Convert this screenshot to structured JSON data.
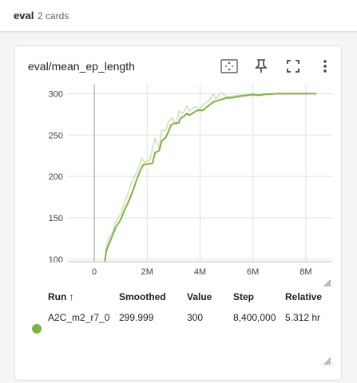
{
  "group": {
    "title": "eval",
    "count": "2 cards"
  },
  "card": {
    "title": "eval/mean_ep_length",
    "tools": [
      "fit-domain-icon",
      "pin-icon",
      "fullscreen-icon",
      "more-vert-icon"
    ]
  },
  "table": {
    "headers": {
      "run": "Run ↑",
      "smoothed": "Smoothed",
      "value": "Value",
      "step": "Step",
      "relative": "Relative"
    },
    "rows": [
      {
        "run": "A2C_m2_r7_0",
        "smoothed": "299.999",
        "value": "300",
        "step": "8,400,000",
        "relative": "5.312 hr",
        "color": "#7cb342"
      }
    ]
  },
  "chart_data": {
    "type": "line",
    "title": "",
    "xlabel": "",
    "ylabel": "",
    "xlim": [
      -1000000,
      9000000
    ],
    "ylim": [
      97,
      312
    ],
    "x_ticks": [
      0,
      2000000,
      4000000,
      6000000,
      8000000
    ],
    "x_tick_labels": [
      "0",
      "2M",
      "4M",
      "6M",
      "8M"
    ],
    "y_ticks": [
      100,
      150,
      200,
      250,
      300
    ],
    "y_tick_labels": [
      "100",
      "150",
      "200",
      "250",
      "300"
    ],
    "grid": true,
    "series_color": "#7cb342",
    "raw_color": "#cfe3b8",
    "series": [
      {
        "name": "A2C_m2_r7_0",
        "smoothed": [
          [
            400000,
            97
          ],
          [
            450000,
            110
          ],
          [
            550000,
            118
          ],
          [
            700000,
            130
          ],
          [
            800000,
            138
          ],
          [
            1000000,
            148
          ],
          [
            1150000,
            160
          ],
          [
            1300000,
            170
          ],
          [
            1450000,
            182
          ],
          [
            1600000,
            196
          ],
          [
            1750000,
            208
          ],
          [
            1850000,
            214
          ],
          [
            2000000,
            215
          ],
          [
            2200000,
            216
          ],
          [
            2300000,
            229
          ],
          [
            2450000,
            231
          ],
          [
            2550000,
            243
          ],
          [
            2700000,
            247
          ],
          [
            2800000,
            254
          ],
          [
            2900000,
            262
          ],
          [
            3000000,
            264
          ],
          [
            3200000,
            265
          ],
          [
            3250000,
            270
          ],
          [
            3400000,
            273
          ],
          [
            3500000,
            276
          ],
          [
            3600000,
            274
          ],
          [
            3750000,
            277
          ],
          [
            3900000,
            280
          ],
          [
            4100000,
            280
          ],
          [
            4300000,
            285
          ],
          [
            4500000,
            290
          ],
          [
            4600000,
            291
          ],
          [
            4800000,
            293
          ],
          [
            5000000,
            295
          ],
          [
            5200000,
            295
          ],
          [
            5500000,
            297
          ],
          [
            5800000,
            298
          ],
          [
            6000000,
            299
          ],
          [
            6200000,
            298
          ],
          [
            6500000,
            299.5
          ],
          [
            7000000,
            300
          ],
          [
            8000000,
            300
          ],
          [
            8400000,
            299.999
          ]
        ],
        "raw": [
          [
            400000,
            97
          ],
          [
            450000,
            114
          ],
          [
            550000,
            126
          ],
          [
            700000,
            133
          ],
          [
            800000,
            145
          ],
          [
            1000000,
            155
          ],
          [
            1100000,
            165
          ],
          [
            1300000,
            182
          ],
          [
            1400000,
            192
          ],
          [
            1600000,
            205
          ],
          [
            1800000,
            222
          ],
          [
            1900000,
            217
          ],
          [
            2100000,
            220
          ],
          [
            2300000,
            246
          ],
          [
            2450000,
            234
          ],
          [
            2550000,
            256
          ],
          [
            2700000,
            255
          ],
          [
            2800000,
            266
          ],
          [
            2950000,
            271
          ],
          [
            3100000,
            262
          ],
          [
            3200000,
            279
          ],
          [
            3350000,
            276
          ],
          [
            3500000,
            285
          ],
          [
            3600000,
            279
          ],
          [
            3800000,
            284
          ],
          [
            4000000,
            282
          ],
          [
            4200000,
            289
          ],
          [
            4350000,
            292
          ],
          [
            4500000,
            300
          ],
          [
            4600000,
            294
          ],
          [
            4800000,
            301
          ],
          [
            5000000,
            296
          ],
          [
            5200000,
            297
          ],
          [
            5400000,
            298
          ],
          [
            5700000,
            299
          ],
          [
            6000000,
            300
          ],
          [
            6300000,
            299
          ],
          [
            7000000,
            300
          ],
          [
            8000000,
            300
          ],
          [
            8400000,
            300
          ]
        ]
      }
    ]
  }
}
